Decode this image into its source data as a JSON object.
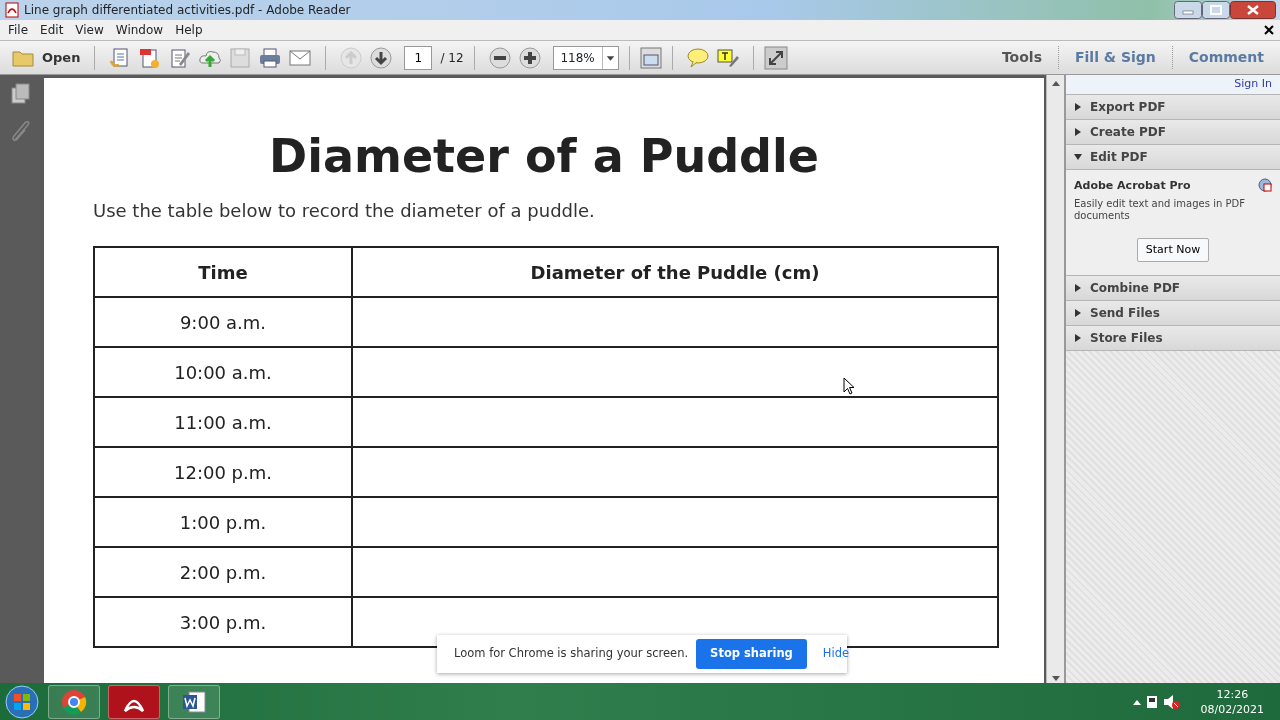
{
  "window": {
    "title": "Line graph differentiated activities.pdf - Adobe Reader"
  },
  "menu": [
    "File",
    "Edit",
    "View",
    "Window",
    "Help"
  ],
  "toolbar": {
    "open_label": "Open",
    "page": "1",
    "page_total": "/ 12",
    "zoom": "118%",
    "tabs": [
      "Tools",
      "Fill & Sign",
      "Comment"
    ]
  },
  "right_pane": {
    "sign_in": "Sign In",
    "panels": [
      {
        "label": "Export PDF",
        "expanded": false
      },
      {
        "label": "Create PDF",
        "expanded": false
      },
      {
        "label": "Edit PDF",
        "expanded": true,
        "heading": "Adobe Acrobat Pro",
        "text": "Easily edit text and images in PDF documents",
        "button": "Start Now"
      },
      {
        "label": "Combine PDF",
        "expanded": false
      },
      {
        "label": "Send Files",
        "expanded": false
      },
      {
        "label": "Store Files",
        "expanded": false
      }
    ]
  },
  "document": {
    "title": "Diameter of a Puddle",
    "instruction": "Use the table below to record the diameter of a puddle.",
    "table": {
      "columns": [
        "Time",
        "Diameter of the Puddle (cm)"
      ],
      "rows": [
        [
          "9:00 a.m."
        ],
        [
          "10:00 a.m."
        ],
        [
          "11:00 a.m."
        ],
        [
          "12:00 p.m."
        ],
        [
          "1:00 p.m."
        ],
        [
          "2:00 p.m."
        ],
        [
          "3:00 p.m."
        ]
      ]
    }
  },
  "loom_bar": {
    "text": "Loom for Chrome is sharing your screen.",
    "stop_button": "Stop sharing",
    "hide_link": "Hide"
  },
  "taskbar": {
    "time": "12:26",
    "date": "08/02/2021"
  }
}
